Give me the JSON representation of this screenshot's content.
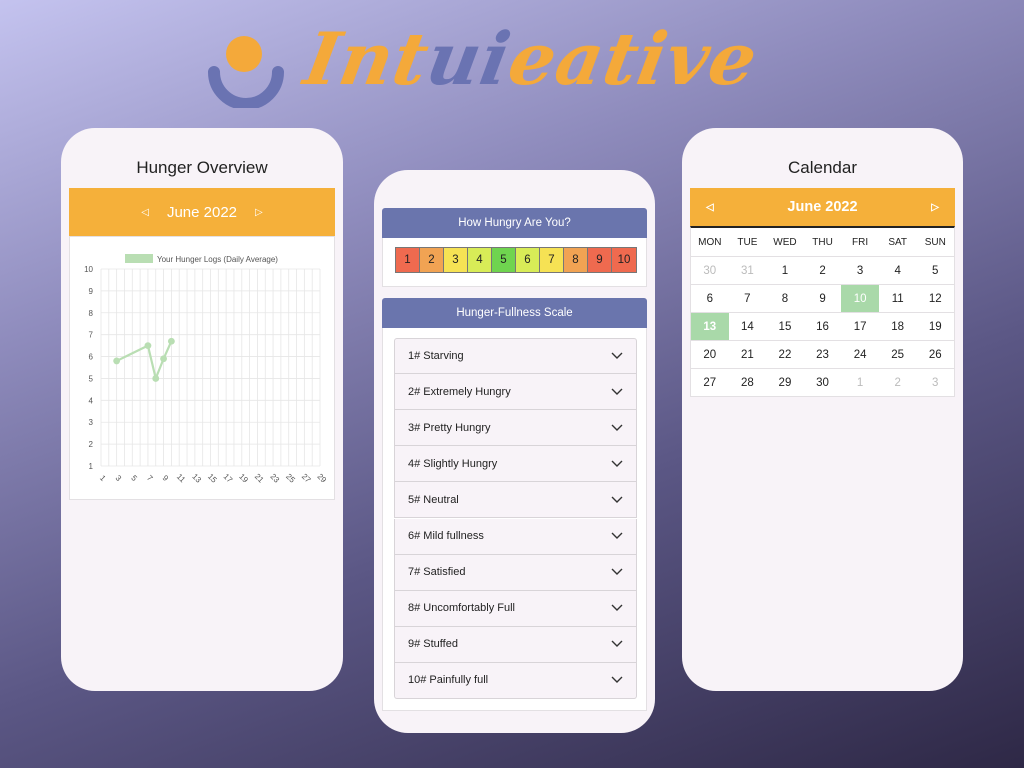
{
  "brand": {
    "name": "Intuieative",
    "name_part1": "Int",
    "name_part2": "ui",
    "name_part3": "eative",
    "colors": {
      "orange": "#f4a93a",
      "blue": "#6a73b2"
    }
  },
  "hunger_overview": {
    "title": "Hunger Overview",
    "month": "June 2022",
    "prev_icon": "chevron-left-icon",
    "next_icon": "chevron-right-icon",
    "chart_data": {
      "type": "line",
      "legend": "Your Hunger Logs (Daily Average)",
      "legend_position": "top",
      "series": [
        {
          "name": "Your Hunger Logs (Daily Average)",
          "x": [
            3,
            7,
            8,
            9,
            10
          ],
          "y": [
            5.8,
            6.5,
            5.0,
            5.9,
            6.7
          ],
          "color": "#b9deb3"
        }
      ],
      "x_ticks": [
        1,
        3,
        5,
        7,
        9,
        11,
        13,
        15,
        17,
        19,
        21,
        23,
        25,
        27,
        29
      ],
      "y_ticks": [
        1,
        2,
        3,
        4,
        5,
        6,
        7,
        8,
        9,
        10
      ],
      "xlim": [
        1,
        29
      ],
      "ylim": [
        1,
        10
      ],
      "grid": true
    }
  },
  "hunger_check": {
    "title": "How Hungry Are You?",
    "scale": [
      {
        "label": "1",
        "color": "#ef6a4f"
      },
      {
        "label": "2",
        "color": "#f1a353"
      },
      {
        "label": "3",
        "color": "#f6e254"
      },
      {
        "label": "4",
        "color": "#d8ec57"
      },
      {
        "label": "5",
        "color": "#6fd44f"
      },
      {
        "label": "6",
        "color": "#d8ec57"
      },
      {
        "label": "7",
        "color": "#f6e254"
      },
      {
        "label": "8",
        "color": "#f1a353"
      },
      {
        "label": "9",
        "color": "#ef6a4f"
      },
      {
        "label": "10",
        "color": "#ef6a4f"
      }
    ]
  },
  "fullness_scale": {
    "title": "Hunger-Fullness Scale",
    "items": [
      "1# Starving",
      "2# Extremely Hungry",
      "3# Pretty Hungry",
      "4# Slightly Hungry",
      "5# Neutral",
      "6# Mild fullness",
      "7# Satisfied",
      "8# Uncomfortably Full",
      "9# Stuffed",
      "10# Painfully full"
    ]
  },
  "calendar": {
    "title": "Calendar",
    "month": "June 2022",
    "weekdays": [
      "MON",
      "TUE",
      "WED",
      "THU",
      "FRI",
      "SAT",
      "SUN"
    ],
    "weeks": [
      [
        {
          "d": "30",
          "m": true
        },
        {
          "d": "31",
          "m": true
        },
        {
          "d": "1"
        },
        {
          "d": "2"
        },
        {
          "d": "3"
        },
        {
          "d": "4"
        },
        {
          "d": "5"
        }
      ],
      [
        {
          "d": "6"
        },
        {
          "d": "7"
        },
        {
          "d": "8"
        },
        {
          "d": "9"
        },
        {
          "d": "10",
          "h": true
        },
        {
          "d": "11"
        },
        {
          "d": "12"
        }
      ],
      [
        {
          "d": "13",
          "h": true,
          "b": true
        },
        {
          "d": "14"
        },
        {
          "d": "15"
        },
        {
          "d": "16"
        },
        {
          "d": "17"
        },
        {
          "d": "18"
        },
        {
          "d": "19"
        }
      ],
      [
        {
          "d": "20"
        },
        {
          "d": "21"
        },
        {
          "d": "22"
        },
        {
          "d": "23"
        },
        {
          "d": "24"
        },
        {
          "d": "25"
        },
        {
          "d": "26"
        }
      ],
      [
        {
          "d": "27"
        },
        {
          "d": "28"
        },
        {
          "d": "29"
        },
        {
          "d": "30"
        },
        {
          "d": "1",
          "m": true
        },
        {
          "d": "2",
          "m": true
        },
        {
          "d": "3",
          "m": true
        }
      ]
    ],
    "highlight_color": "#a9d9a9"
  }
}
